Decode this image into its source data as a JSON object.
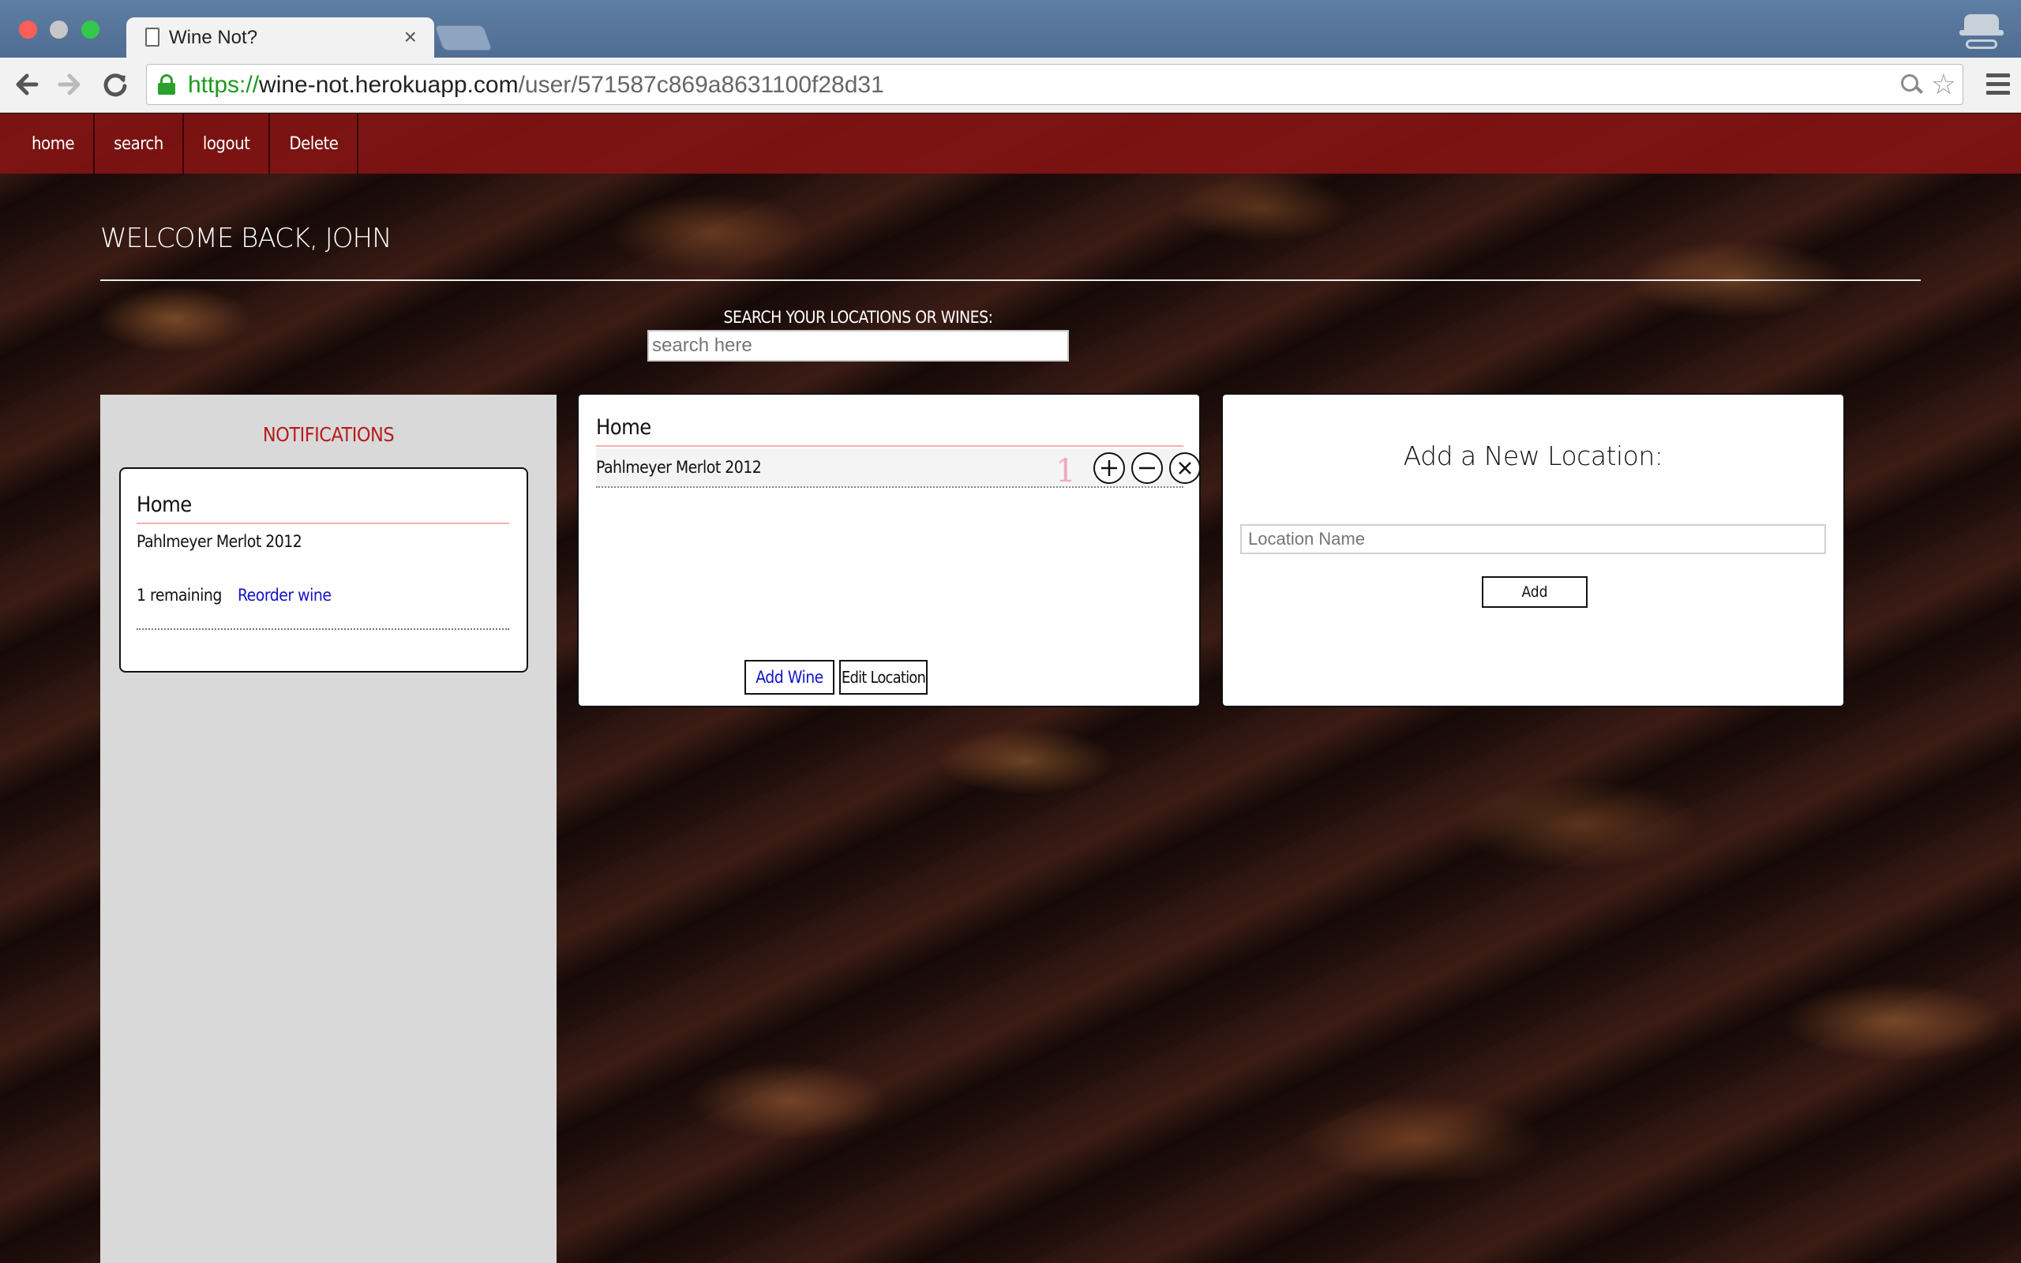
{
  "browser": {
    "tab_title": "Wine Not?",
    "tab_close": "×",
    "url_scheme": "https://",
    "url_host": "wine-not.herokuapp.com",
    "url_path": "/user/571587c869a8631100f28d31",
    "icons": [
      "back-arrow-icon",
      "forward-arrow-icon",
      "reload-icon",
      "lock-icon",
      "zoom-icon",
      "bookmark-star-icon",
      "menu-icon",
      "incognito-icon"
    ]
  },
  "site_nav": {
    "items": [
      "home",
      "search",
      "logout",
      "Delete"
    ]
  },
  "welcome": "WELCOME BACK, JOHN",
  "search": {
    "label": "SEARCH YOUR LOCATIONS OR WINES:",
    "placeholder": "search here"
  },
  "notifications": {
    "title": "NOTIFICATIONS",
    "card": {
      "location": "Home",
      "wine": "Pahlmeyer Merlot 2012",
      "remaining": "1 remaining",
      "reorder": "Reorder wine"
    }
  },
  "location_panel": {
    "title": "Home",
    "wines": [
      {
        "name": "Pahlmeyer Merlot 2012",
        "quantity": "1"
      }
    ],
    "add_wine": "Add Wine",
    "edit_location": "Edit Location"
  },
  "new_location": {
    "title": "Add a New Location:",
    "placeholder": "Location Name",
    "add": "Add"
  },
  "colors": {
    "nav_bar": "#821414",
    "notifications_title": "#b71c1c",
    "link": "#1414c8",
    "quantity": "#f3a9c0"
  }
}
